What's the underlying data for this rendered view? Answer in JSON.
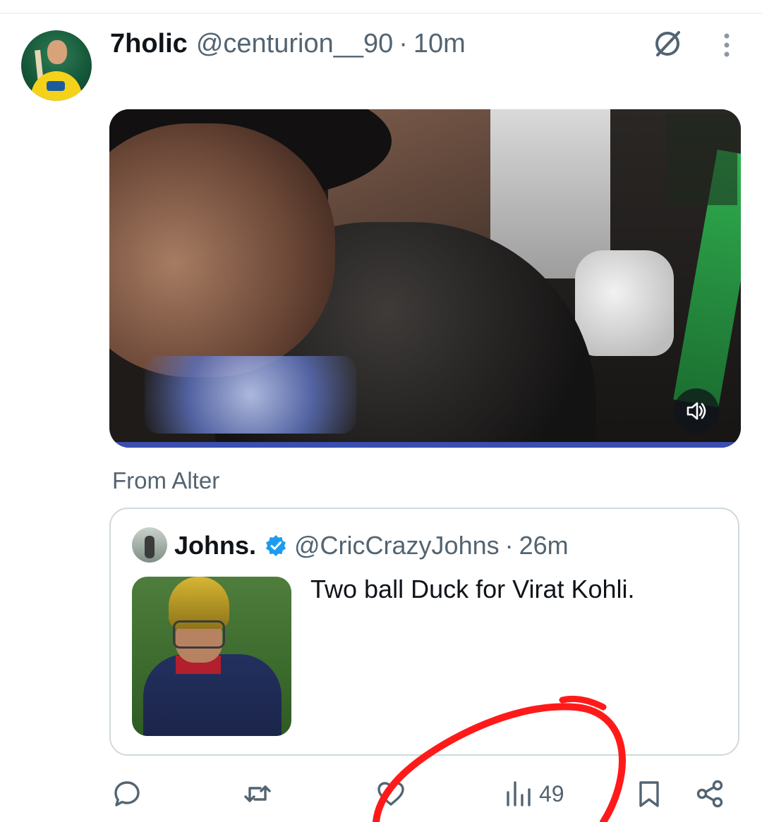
{
  "tweet": {
    "author_name": "7holic",
    "author_handle": "@centurion__90",
    "separator": "·",
    "time": "10m",
    "source_label": "From Alter"
  },
  "quoted_tweet": {
    "author_name": "Johns.",
    "author_handle": "@CricCrazyJohns",
    "separator": "·",
    "time": "26m",
    "text": "Two ball Duck for Virat Kohli.",
    "verified": true
  },
  "actions": {
    "reply_icon": "comment-icon",
    "retweet_icon": "retweet-icon",
    "like_icon": "heart-icon",
    "views_icon": "bar-chart-icon",
    "views_count": "49",
    "bookmark_icon": "bookmark-icon",
    "share_icon": "share-icon"
  },
  "header_icons": {
    "grok": "grok-slash-circle-icon",
    "more": "vertical-dots-icon"
  },
  "video": {
    "mute_icon": "speaker-icon"
  },
  "colors": {
    "primary_text": "#0f1419",
    "secondary_text": "#536471",
    "verified_blue": "#1d9bf0",
    "border": "#cfd9de",
    "annotation_red": "#ff1a1a"
  }
}
